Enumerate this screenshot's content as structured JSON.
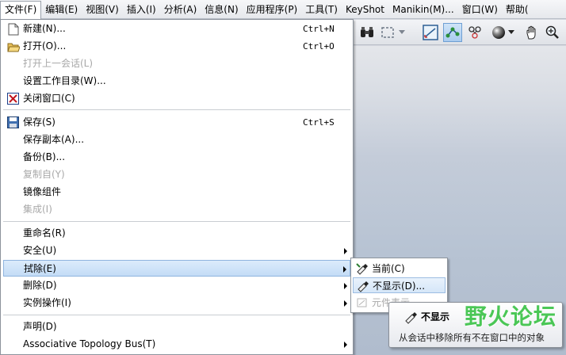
{
  "menubar": {
    "items": [
      {
        "label": "文件(F)"
      },
      {
        "label": "编辑(E)"
      },
      {
        "label": "视图(V)"
      },
      {
        "label": "插入(I)"
      },
      {
        "label": "分析(A)"
      },
      {
        "label": "信息(N)"
      },
      {
        "label": "应用程序(P)"
      },
      {
        "label": "工具(T)"
      },
      {
        "label": "KeyShot"
      },
      {
        "label": "Manikin(M)..."
      },
      {
        "label": "窗口(W)"
      },
      {
        "label": "帮助("
      }
    ]
  },
  "toolbar": {
    "icons": [
      "binoculars-icon",
      "selection-box-icon",
      "dropdown-arrow-icon",
      "chart-view-icon",
      "datum-icon",
      "network-icon",
      "shading-sphere-icon",
      "pan-hand-icon",
      "zoom-in-icon"
    ]
  },
  "file_menu": {
    "items": [
      {
        "label": "新建(N)...",
        "shortcut": "Ctrl+N",
        "icon": "new-file-icon",
        "enabled": true
      },
      {
        "label": "打开(O)...",
        "shortcut": "Ctrl+O",
        "icon": "open-folder-icon",
        "enabled": true
      },
      {
        "label": "打开上一会话(L)",
        "shortcut": "",
        "icon": "",
        "enabled": false
      },
      {
        "label": "设置工作目录(W)...",
        "shortcut": "",
        "icon": "",
        "enabled": true
      },
      {
        "label": "关闭窗口(C)",
        "shortcut": "",
        "icon": "close-window-icon",
        "enabled": true
      },
      {
        "label": "保存(S)",
        "shortcut": "Ctrl+S",
        "icon": "save-disk-icon",
        "enabled": true
      },
      {
        "label": "保存副本(A)...",
        "shortcut": "",
        "icon": "",
        "enabled": true
      },
      {
        "label": "备份(B)...",
        "shortcut": "",
        "icon": "",
        "enabled": true
      },
      {
        "label": "复制自(Y)",
        "shortcut": "",
        "icon": "",
        "enabled": false
      },
      {
        "label": "镜像组件",
        "shortcut": "",
        "icon": "",
        "enabled": true
      },
      {
        "label": "集成(I)",
        "shortcut": "",
        "icon": "",
        "enabled": false
      },
      {
        "label": "重命名(R)",
        "shortcut": "",
        "icon": "",
        "enabled": true
      },
      {
        "label": "安全(U)",
        "shortcut": "",
        "icon": "",
        "enabled": true
      },
      {
        "label": "拭除(E)",
        "shortcut": "",
        "icon": "",
        "enabled": true
      },
      {
        "label": "删除(D)",
        "shortcut": "",
        "icon": "",
        "enabled": true
      },
      {
        "label": "实例操作(I)",
        "shortcut": "",
        "icon": "",
        "enabled": true
      },
      {
        "label": "声明(D)",
        "shortcut": "",
        "icon": "",
        "enabled": true
      },
      {
        "label": "Associative Topology Bus(T)",
        "shortcut": "",
        "icon": "",
        "enabled": true
      }
    ]
  },
  "erase_submenu": {
    "items": [
      {
        "label": "当前(C)",
        "icon": "erase-current-icon",
        "enabled": true
      },
      {
        "label": "不显示(D)...",
        "icon": "erase-not-displayed-icon",
        "enabled": true
      },
      {
        "label": "元件表示",
        "icon": "erase-component-icon",
        "enabled": false
      }
    ]
  },
  "tooltip": {
    "title": "不显示",
    "description": "从会话中移除所有不在窗口中的对象"
  },
  "watermark": {
    "text": "野火论坛"
  },
  "colors": {
    "highlight": "#c3dcf6",
    "disabled_text": "#a8a8a8",
    "workspace": "#b7c3d3",
    "watermark": "#2dbf3a"
  }
}
